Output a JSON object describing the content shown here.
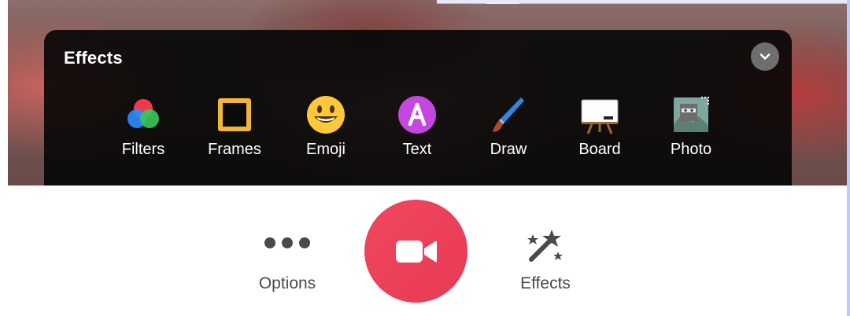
{
  "panel": {
    "title": "Effects",
    "tools": [
      {
        "label": "Filters",
        "icon": "filters-icon"
      },
      {
        "label": "Frames",
        "icon": "frames-icon"
      },
      {
        "label": "Emoji",
        "icon": "emoji-icon"
      },
      {
        "label": "Text",
        "icon": "text-icon"
      },
      {
        "label": "Draw",
        "icon": "draw-icon"
      },
      {
        "label": "Board",
        "icon": "board-icon"
      },
      {
        "label": "Photo",
        "icon": "photo-icon"
      }
    ]
  },
  "toolbar": {
    "options_label": "Options",
    "effects_label": "Effects"
  },
  "colors": {
    "record": "#e8435a",
    "panel_bg": "#050505",
    "frames": "#f2b636",
    "text_badge": "#c448dd"
  }
}
